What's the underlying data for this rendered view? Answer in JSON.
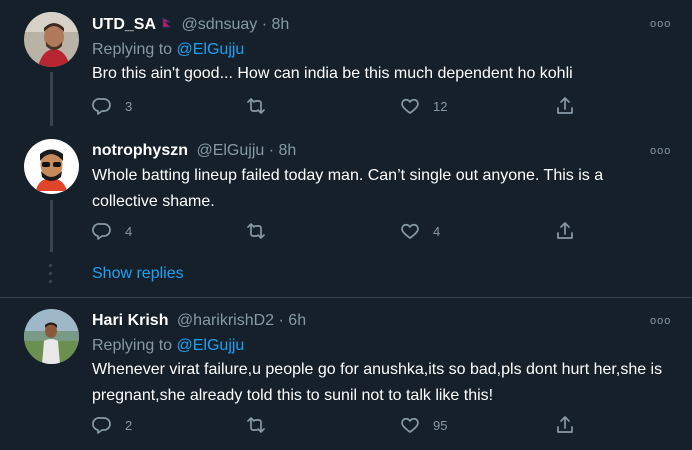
{
  "tweets": [
    {
      "name": "UTD_SA",
      "handle": "@sdnsuay",
      "sep": " · ",
      "time": "8h",
      "replying_prefix": "Replying to ",
      "replying_to": "@ElGujju",
      "text": "Bro this ain't good... How can india be this much dependent ho kohli",
      "replies": "3",
      "retweets": "",
      "likes": "12"
    },
    {
      "name": "notrophyszn",
      "handle": "@ElGujju",
      "sep": " · ",
      "time": "8h",
      "text": "Whole batting lineup failed today man. Can’t single out anyone. This is a collective shame.",
      "replies": "4",
      "retweets": "",
      "likes": "4"
    },
    {
      "name": "Hari Krish",
      "handle": "@harikrishD2",
      "sep": " · ",
      "time": "6h",
      "replying_prefix": "Replying to ",
      "replying_to": "@ElGujju",
      "text": "Whenever virat failure,u people go for anushka,its so bad,pls dont hurt her,she is pregnant,she already told this to sunil not to talk like this!",
      "replies": "2",
      "retweets": "",
      "likes": "95"
    }
  ],
  "show_replies": "Show replies",
  "more_glyph": "ooo",
  "colors": {
    "background": "#15202b",
    "accent": "#1da1f2",
    "muted": "#8899a6",
    "border": "#38444d"
  },
  "icons": [
    "reply-icon",
    "retweet-icon",
    "like-icon",
    "share-icon",
    "more-icon"
  ]
}
